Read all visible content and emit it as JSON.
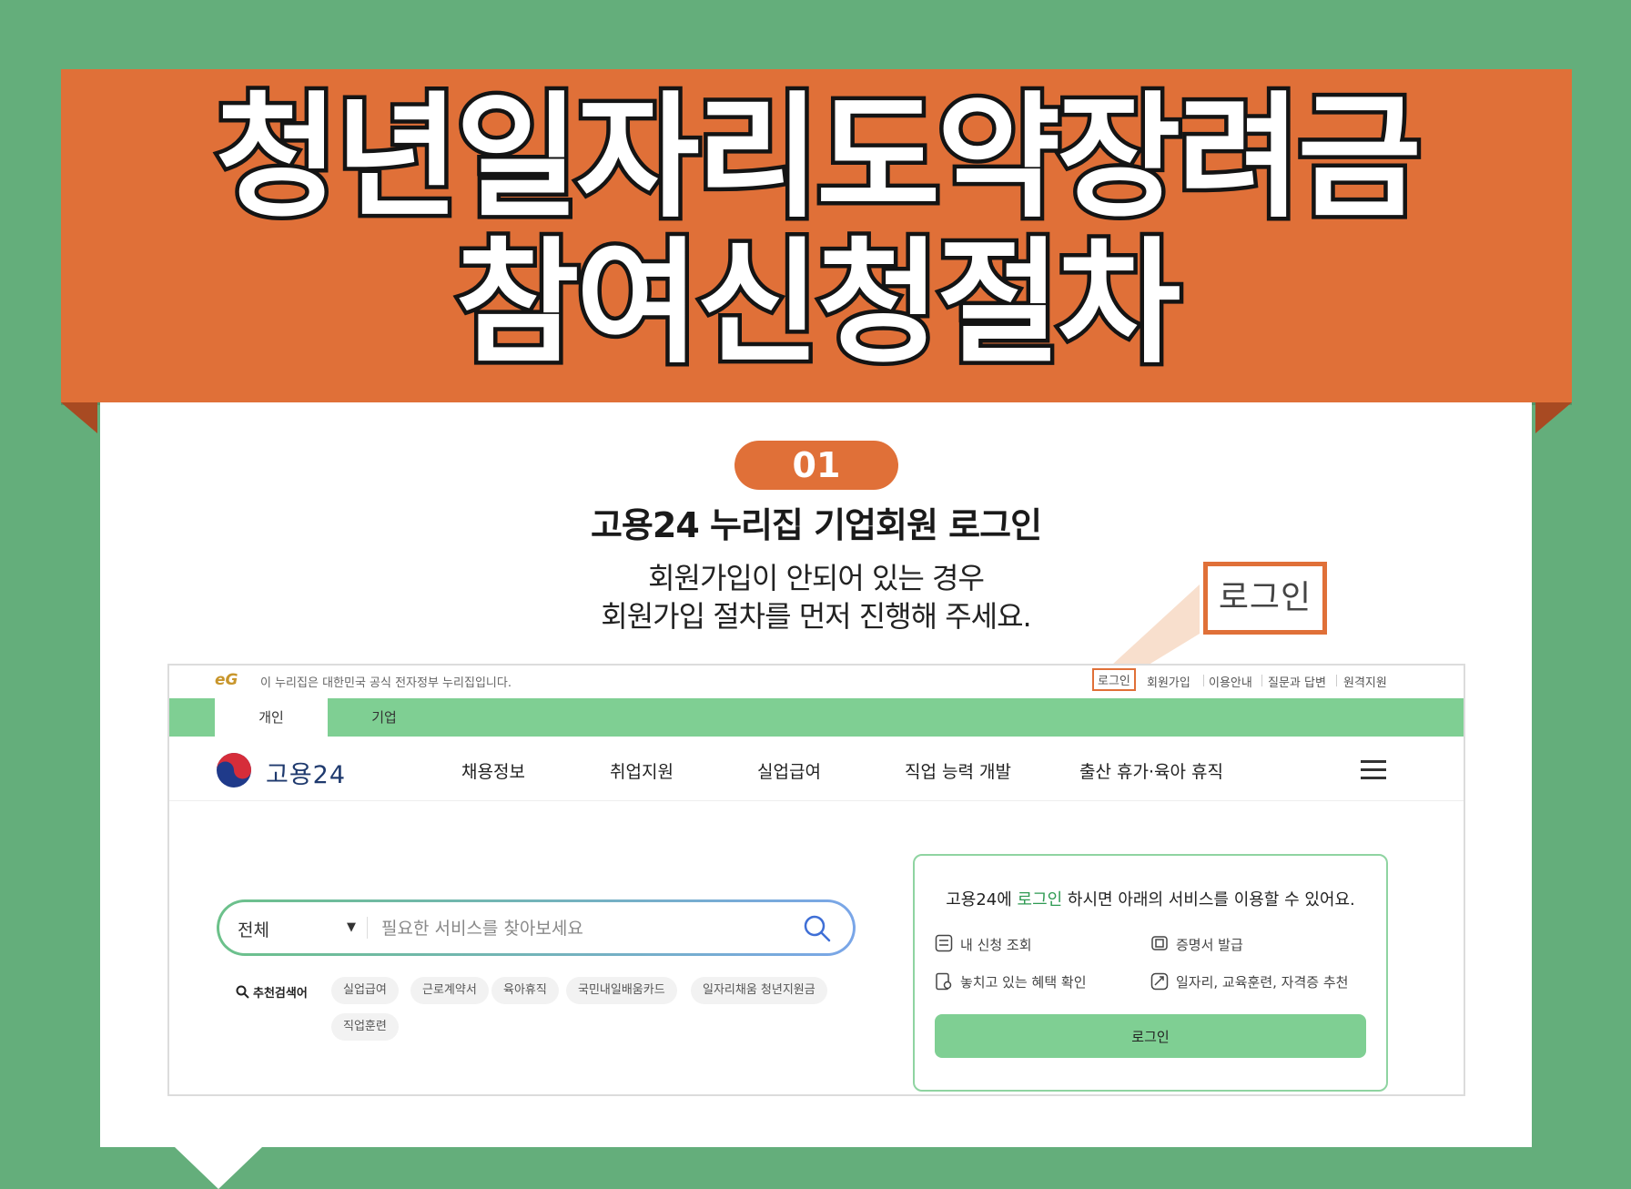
{
  "banner": {
    "title_line1": "청년일자리도약장려금",
    "title_line2": "참여신청절차"
  },
  "step": {
    "number": "01",
    "heading": "고용24 누리집 기업회원 로그인",
    "desc_line1": "회원가입이 안되어 있는 경우",
    "desc_line2": "회원가입 절차를 먼저 진행해 주세요.",
    "zoom_label": "로그인"
  },
  "site": {
    "gov_logo": "eG",
    "gov_notice": "이 누리집은 대한민국 공식 전자정부 누리집입니다.",
    "util_links": [
      "로그인",
      "회원가입",
      "이용안내",
      "질문과 답변",
      "원격지원"
    ],
    "tabs": [
      "개인",
      "기업"
    ],
    "logo_text": "고용24",
    "nav": [
      "채용정보",
      "취업지원",
      "실업급여",
      "직업 능력 개발",
      "출산 휴가·육아 휴직"
    ],
    "search": {
      "category": "전체",
      "placeholder": "필요한 서비스를 찾아보세요"
    },
    "recommended_label": "추천검색어",
    "recommended": [
      "실업급여",
      "근로계약서",
      "육아휴직",
      "국민내일배움카드",
      "일자리채움 청년지원금",
      "직업훈련"
    ],
    "login_panel": {
      "msg_pre": "고용24에 ",
      "msg_link": "로그인",
      "msg_post": " 하시면 아래의 서비스를 이용할 수 있어요.",
      "services": [
        "내 신청 조회",
        "증명서 발급",
        "놓치고 있는 혜택 확인",
        "일자리, 교육훈련, 자격증 추천"
      ],
      "button": "로그인"
    }
  },
  "colors": {
    "background": "#64ae7b",
    "accent": "#e07038",
    "site_green": "#7fcf93"
  }
}
